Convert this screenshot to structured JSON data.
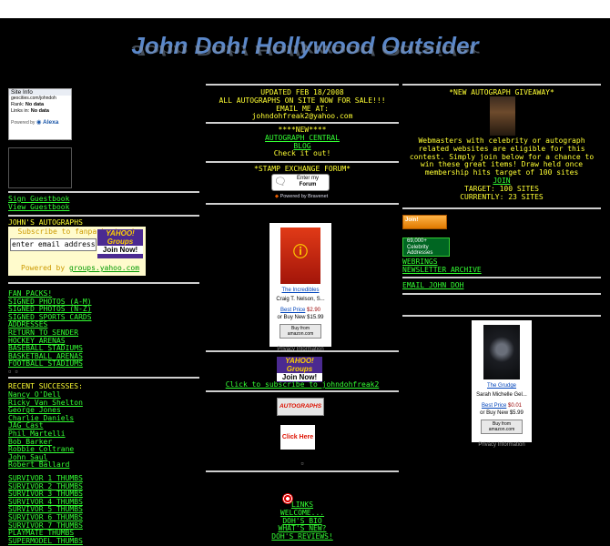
{
  "header": {
    "title": "John Doh! Hollywood Outsider"
  },
  "left": {
    "site_info": {
      "title": "Site Info",
      "url": "geocities.com/johndoh",
      "rank_label": "Rank:",
      "rank_value": "No data",
      "links_label": "Links in:",
      "links_value": "No data",
      "powered": "Powered by",
      "brand": "Alexa"
    },
    "guestbook": [
      "Sign Guestbook",
      "View Guestbook"
    ],
    "autographs_heading": "JOHN'S AUTOGRAPHS",
    "subscribe": {
      "title": "Subscribe to fanpacknetwork",
      "input_value": "enter email address",
      "powered": "Powered by",
      "groups_link": "groups.yahoo.com"
    },
    "yahoo": {
      "line1": "YAHOO!",
      "line2": "Groups",
      "line3": "Join Now!"
    },
    "links1": [
      "FAN PACKS!",
      "SIGNED PHOTOS (A-M)",
      "SIGNED PHOTOS (N-Z)",
      "SIGNED SPORTS CARDS",
      "ADDRESSES",
      "RETURN TO SENDER",
      "HOCKEY ARENAS",
      "BASEBALL STADIUMS",
      "BASKETBALL ARENAS",
      "FOOTBALL STADIUMS"
    ],
    "recent_heading": "RECENT SUCCESSES:",
    "recent": [
      "Nancy O'Dell",
      "Ricky Van Shelton",
      "George Jones",
      "Charlie Daniels",
      "JAG Cast",
      "Phil Martelli",
      "Bob Barker",
      "Robbie Coltrane",
      "John Saul",
      "Robert Ballard"
    ],
    "survivor": [
      "SURVIVOR 1 THUMBS",
      "SURVIVOR 2 THUMBS",
      "SURVIVOR 3 THUMBS",
      "SURVIVOR 4 THUMBS",
      "SURVIVOR 5 THUMBS",
      "SURVIVOR 6 THUMBS",
      "SURVIVOR 7 THUMBS",
      "PLAYMATE THUMBS",
      "SUPERMODEL THUMBS"
    ]
  },
  "mid": {
    "updated": "UPDATED FEB 18/2008",
    "sale": "ALL AUTOGRAPHS ON SITE NOW FOR SALE!!!",
    "email_me": "EMAIL ME AT:",
    "email": "johndohfreak2@yahoo.com",
    "new_label": "****NEW****",
    "new_links": [
      "AUTOGRAPH CENTRAL",
      "BLOG"
    ],
    "check": "Check it out!",
    "stamp": "*STAMP EXCHANGE FORUM*",
    "forum_btn": {
      "line1": "Enter my",
      "line2": "Forum"
    },
    "bravenet": "Powered by Bravenet",
    "amazon1": {
      "title": "The Incredibles",
      "meta": "Craig T. Nelson, S...",
      "best_price_label": "Best Price",
      "best_price": "$2.90",
      "buy_new": "or Buy New $15.99",
      "btn": "Buy from amazon.com",
      "privacy": "Privacy Information"
    },
    "subscribe_link": "Click to subscribe to johndohfreak2",
    "autographs_btn": "AUTOGRAPHS",
    "click_here": "Click Here",
    "links": [
      "LINKS",
      "WELCOME...",
      "DOH'S BIO",
      "WHAT'S NEW?",
      "DOH'S REVIEWS!"
    ]
  },
  "right": {
    "giveaway_title": "*NEW AUTOGRAPH GIVEAWAY*",
    "giveaway_text": "Webmasters with celebrity or autograph related websites are eligible for this contest. Simply join below for a chance to win these great items! Draw held once membership hits target of 100 sites",
    "join": "JOIN",
    "target": "TARGET: 100 SITES",
    "currently": "CURRENTLY: 23 SITES",
    "join_btn": "Join!",
    "celebrity_badge": {
      "line1": "69,000+",
      "line2": "Celebrity",
      "line3": "Addresses"
    },
    "links": [
      "WEBRINGS",
      "NEWSLETTER ARCHIVE"
    ],
    "email_link": "EMAIL JOHN DOH",
    "amazon2": {
      "title": "The Grudge",
      "meta": "Sarah Michelle Gel...",
      "best_price_label": "Best Price",
      "best_price": "$0.01",
      "buy_new": "or Buy New $5.99",
      "btn": "Buy from amazon.com",
      "privacy": "Privacy Information"
    }
  },
  "colors": {
    "background": "#000000",
    "link": "#33ff33",
    "highlight": "#ffff33",
    "title": "#5a87c9"
  }
}
